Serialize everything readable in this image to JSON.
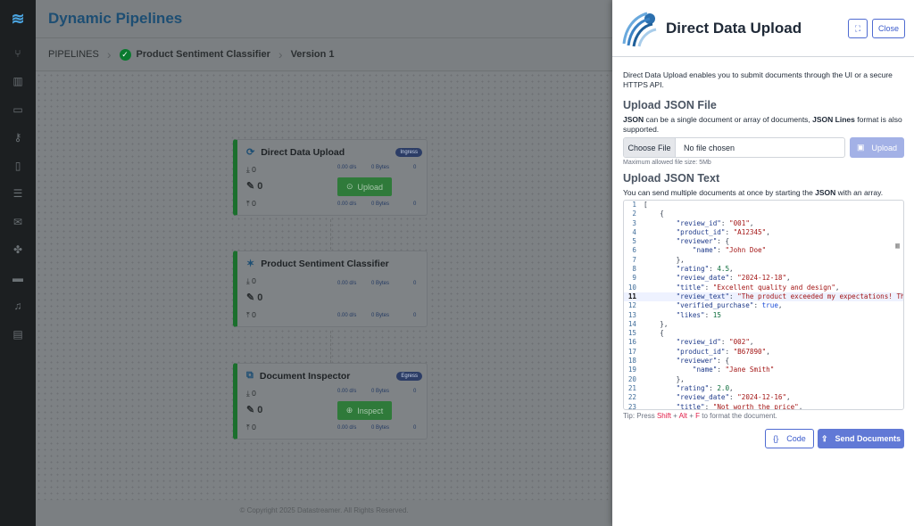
{
  "app": {
    "title": "Dynamic Pipelines"
  },
  "sidenav": {
    "icons": [
      "app-logo-icon",
      "branch-icon",
      "chart-icon",
      "archive-icon",
      "key-icon",
      "book-icon",
      "list-icon",
      "mail-icon",
      "puzzle-icon",
      "card-icon",
      "bell-icon",
      "document-icon"
    ]
  },
  "breadcrumb": {
    "root": "PIPELINES",
    "pipeline": "Product Sentiment Classifier",
    "version": "Version 1"
  },
  "nodes": [
    {
      "title": "Direct Data Upload",
      "badge": "Ingress",
      "in": "0",
      "mid": "0",
      "out": "0",
      "stat_rate": "0.00 d/s",
      "stat_bytes": "0 Bytes",
      "stat_count": "0",
      "button": "Upload"
    },
    {
      "title": "Product Sentiment Classifier",
      "badge": "",
      "in": "0",
      "mid": "0",
      "out": "0",
      "stat_rate": "0.00 d/s",
      "stat_bytes": "0 Bytes",
      "stat_count": "0",
      "button": ""
    },
    {
      "title": "Document Inspector",
      "badge": "Egress",
      "in": "0",
      "mid": "0",
      "out": "0",
      "stat_rate": "0.00 d/s",
      "stat_bytes": "0 Bytes",
      "stat_count": "0",
      "button": "Inspect"
    }
  ],
  "footer": {
    "copyright": "© Copyright 2025 Datastreamer. All Rights Reserved."
  },
  "panel": {
    "title": "Direct Data Upload",
    "expand_label": "⛶",
    "close_label": "Close",
    "description": "Direct Data Upload enables you to submit documents through the UI or a secure HTTPS API.",
    "file_section": {
      "heading": "Upload JSON File",
      "desc_pre": "JSON",
      "desc_mid": " can be a single document or array of documents, ",
      "desc_bold2": "JSON Lines",
      "desc_post": " format is also supported.",
      "choose_label": "Choose File",
      "file_status": "No file chosen",
      "upload_label": "Upload",
      "max_size": "Maximum allowed file size: 5Mb"
    },
    "text_section": {
      "heading": "Upload JSON Text",
      "desc_pre": "You can send multiple documents at once by starting the ",
      "desc_bold": "JSON",
      "desc_post": " with an array."
    },
    "editor": {
      "current_line": 11,
      "lines": [
        "[",
        "    {",
        "        \"review_id\": \"001\",",
        "        \"product_id\": \"A12345\",",
        "        \"reviewer\": {",
        "            \"name\": \"John Doe\"",
        "        },",
        "        \"rating\": 4.5,",
        "        \"review_date\": \"2024-12-18\",",
        "        \"title\": \"Excellent quality and design\",",
        "        \"review_text\": \"The product exceeded my expectations! The quali",
        "        \"verified_purchase\": true,",
        "        \"likes\": 15",
        "    },",
        "    {",
        "        \"review_id\": \"002\",",
        "        \"product_id\": \"B67890\",",
        "        \"reviewer\": {",
        "            \"name\": \"Jane Smith\"",
        "        },",
        "        \"rating\": 2.0,",
        "        \"review_date\": \"2024-12-16\",",
        "        \"title\": \"Not worth the price\","
      ]
    },
    "tip": {
      "pre": "Tip: Press ",
      "k1": "Shift",
      "plus1": " + ",
      "k2": "Alt",
      "plus2": " + ",
      "k3": "F",
      "post": " to format the document."
    },
    "code_label": "Code",
    "send_label": "Send Documents"
  }
}
